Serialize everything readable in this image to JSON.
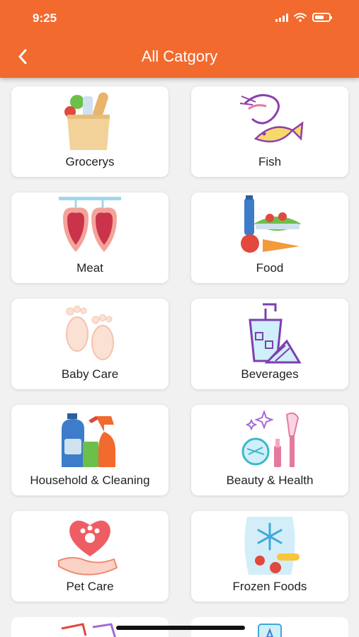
{
  "status_bar": {
    "time": "9:25",
    "icons": [
      "signal-icon",
      "wifi-icon",
      "battery-icon"
    ]
  },
  "header": {
    "title": "All Catgory",
    "back_icon": "chevron-left-icon",
    "color": "#f26a2e"
  },
  "categories": [
    {
      "label": "Grocerys",
      "icon": "grocery-bag-icon"
    },
    {
      "label": "Fish",
      "icon": "fish-shrimp-icon"
    },
    {
      "label": "Meat",
      "icon": "meat-icon"
    },
    {
      "label": "Food",
      "icon": "food-icon"
    },
    {
      "label": "Baby Care",
      "icon": "baby-feet-icon"
    },
    {
      "label": "Beverages",
      "icon": "beverage-icon"
    },
    {
      "label": "Household & Cleaning",
      "icon": "cleaning-supplies-icon"
    },
    {
      "label": "Beauty & Health",
      "icon": "beauty-cosmetics-icon"
    },
    {
      "label": "Pet Care",
      "icon": "pet-care-icon"
    },
    {
      "label": "Frozen Foods",
      "icon": "frozen-food-icon"
    }
  ]
}
